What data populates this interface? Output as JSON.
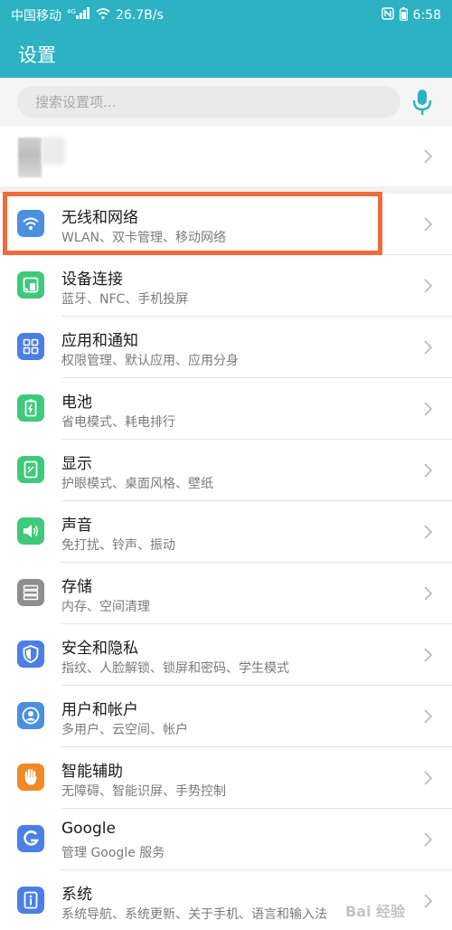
{
  "status_bar": {
    "carrier": "中国移动",
    "speed": "26.7B/s",
    "time": "6:58"
  },
  "header": {
    "title": "设置"
  },
  "search": {
    "placeholder": "搜索设置项..."
  },
  "colors": {
    "primary": "#2cb2c2",
    "highlight": "#f26a3b",
    "wifi": "#4b8fdf",
    "device": "#3ec97b",
    "apps": "#4b7fe6",
    "battery": "#3ec97b",
    "display": "#3ec97b",
    "sound": "#3ec97b",
    "storage": "#8e8e8e",
    "security": "#4b7fe6",
    "users": "#4b8fdf",
    "assist": "#f08a24",
    "google": "#4b7fe6",
    "system": "#4b7fe6"
  },
  "settings": [
    {
      "title": "无线和网络",
      "subtitle": "WLAN、双卡管理、移动网络",
      "icon": "wifi-icon"
    },
    {
      "title": "设备连接",
      "subtitle": "蓝牙、NFC、手机投屏",
      "icon": "device-connect-icon"
    },
    {
      "title": "应用和通知",
      "subtitle": "权限管理、默认应用、应用分身",
      "icon": "apps-icon"
    },
    {
      "title": "电池",
      "subtitle": "省电模式、耗电排行",
      "icon": "battery-icon"
    },
    {
      "title": "显示",
      "subtitle": "护眼模式、桌面风格、壁纸",
      "icon": "display-icon"
    },
    {
      "title": "声音",
      "subtitle": "免打扰、铃声、振动",
      "icon": "sound-icon"
    },
    {
      "title": "存储",
      "subtitle": "内存、空间清理",
      "icon": "storage-icon"
    },
    {
      "title": "安全和隐私",
      "subtitle": "指纹、人脸解锁、锁屏和密码、学生模式",
      "icon": "shield-icon"
    },
    {
      "title": "用户和帐户",
      "subtitle": "多用户、云空间、帐户",
      "icon": "user-icon"
    },
    {
      "title": "智能辅助",
      "subtitle": "无障碍、智能识屏、手势控制",
      "icon": "hand-icon"
    },
    {
      "title": "Google",
      "subtitle": "管理 Google 服务",
      "icon": "google-icon"
    },
    {
      "title": "系统",
      "subtitle": "系统导航、系统更新、关于手机、语言和输入法",
      "icon": "system-info-icon"
    }
  ],
  "watermark": "Bai 经验"
}
